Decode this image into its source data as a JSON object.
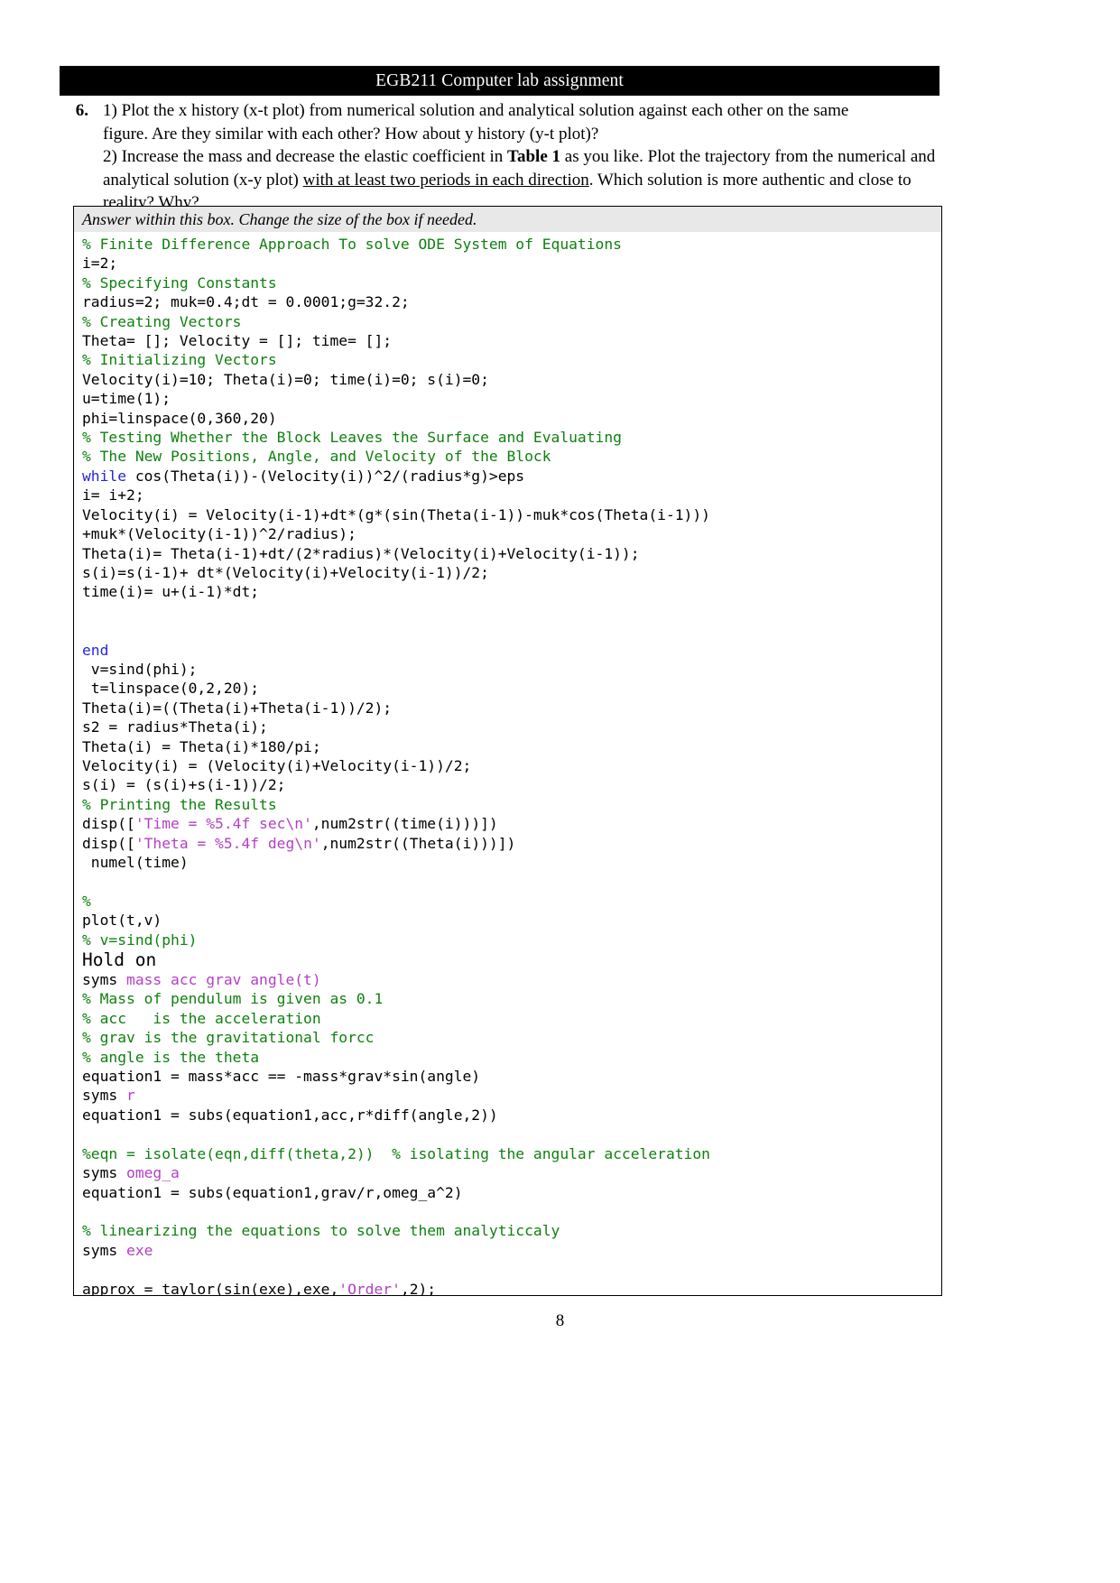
{
  "header": {
    "title": "EGB211 Computer lab assignment"
  },
  "question": {
    "number": "6.",
    "lines": [
      "1) Plot the x history (x-t plot) from numerical solution and analytical solution against each other on the same",
      "figure. Are they similar with each other? How about y history (y-t plot)?"
    ],
    "part2_pre": "2) Increase the mass and decrease the elastic coefficient in ",
    "part2_bold": "Table 1",
    "part2_mid": " as you like. Plot the trajectory from the",
    "part2_line2_pre": "numerical and analytical solution (x-y plot) ",
    "part2_underline": "with at least two periods in each direction",
    "part2_line2_post": ". Which solution is more",
    "part2_line3": "authentic and close to reality? Why?"
  },
  "answer_box": {
    "hint": "Answer within this box. Change the size of the box if needed."
  },
  "code": {
    "lines": [
      [
        {
          "t": "comment",
          "s": "% Finite Difference Approach To solve ODE System of Equations"
        }
      ],
      [
        {
          "t": "plain",
          "s": "i=2;"
        }
      ],
      [
        {
          "t": "comment",
          "s": "% Specifying Constants"
        }
      ],
      [
        {
          "t": "plain",
          "s": "radius=2; muk=0.4;dt = 0.0001;g=32.2;"
        }
      ],
      [
        {
          "t": "comment",
          "s": "% Creating Vectors"
        }
      ],
      [
        {
          "t": "plain",
          "s": "Theta= []; Velocity = []; time= [];"
        }
      ],
      [
        {
          "t": "comment",
          "s": "% Initializing Vectors"
        }
      ],
      [
        {
          "t": "plain",
          "s": "Velocity(i)=10; Theta(i)=0; time(i)=0; s(i)=0;"
        }
      ],
      [
        {
          "t": "plain",
          "s": "u=time(1);"
        }
      ],
      [
        {
          "t": "plain",
          "s": "phi=linspace(0,360,20)"
        }
      ],
      [
        {
          "t": "comment",
          "s": "% Testing Whether the Block Leaves the Surface and Evaluating"
        }
      ],
      [
        {
          "t": "comment",
          "s": "% The New Positions, Angle, and Velocity of the Block"
        }
      ],
      [
        {
          "t": "keyword",
          "s": "while"
        },
        {
          "t": "plain",
          "s": " cos(Theta(i))-(Velocity(i))^2/(radius*g)>eps"
        }
      ],
      [
        {
          "t": "plain",
          "s": "i= i+2;"
        }
      ],
      [
        {
          "t": "plain",
          "s": "Velocity(i) = Velocity(i-1)+dt*(g*(sin(Theta(i-1))-muk*cos(Theta(i-1)))"
        }
      ],
      [
        {
          "t": "plain",
          "s": "+muk*(Velocity(i-1))^2/radius);"
        }
      ],
      [
        {
          "t": "plain",
          "s": "Theta(i)= Theta(i-1)+dt/(2*radius)*(Velocity(i)+Velocity(i-1));"
        }
      ],
      [
        {
          "t": "plain",
          "s": "s(i)=s(i-1)+ dt*(Velocity(i)+Velocity(i-1))/2;"
        }
      ],
      [
        {
          "t": "plain",
          "s": "time(i)= u+(i-1)*dt;"
        }
      ],
      [
        {
          "t": "plain",
          "s": ""
        }
      ],
      [
        {
          "t": "plain",
          "s": ""
        }
      ],
      [
        {
          "t": "keyword",
          "s": "end"
        }
      ],
      [
        {
          "t": "plain",
          "s": " v=sind(phi);"
        }
      ],
      [
        {
          "t": "plain",
          "s": " t=linspace(0,2,20);"
        }
      ],
      [
        {
          "t": "plain",
          "s": "Theta(i)=((Theta(i)+Theta(i-1))/2);"
        }
      ],
      [
        {
          "t": "plain",
          "s": "s2 = radius*Theta(i);"
        }
      ],
      [
        {
          "t": "plain",
          "s": "Theta(i) = Theta(i)*180/pi;"
        }
      ],
      [
        {
          "t": "plain",
          "s": "Velocity(i) = (Velocity(i)+Velocity(i-1))/2;"
        }
      ],
      [
        {
          "t": "plain",
          "s": "s(i) = (s(i)+s(i-1))/2;"
        }
      ],
      [
        {
          "t": "comment",
          "s": "% Printing the Results"
        }
      ],
      [
        {
          "t": "plain",
          "s": "disp(["
        },
        {
          "t": "string",
          "s": "'Time = %5.4f sec\\n'"
        },
        {
          "t": "plain",
          "s": ",num2str((time(i)))])"
        }
      ],
      [
        {
          "t": "plain",
          "s": "disp(["
        },
        {
          "t": "string",
          "s": "'Theta = %5.4f deg\\n'"
        },
        {
          "t": "plain",
          "s": ",num2str((Theta(i)))])"
        }
      ],
      [
        {
          "t": "plain",
          "s": " numel(time)"
        }
      ],
      [
        {
          "t": "plain",
          "s": ""
        }
      ],
      [
        {
          "t": "comment",
          "s": "%"
        }
      ],
      [
        {
          "t": "plain",
          "s": "plot(t,v)"
        }
      ],
      [
        {
          "t": "comment",
          "s": "% v=sind(phi)"
        }
      ],
      [
        {
          "t": "plain",
          "s": "Hold on",
          "big": true
        }
      ],
      [
        {
          "t": "plain",
          "s": "syms "
        },
        {
          "t": "string",
          "s": "mass acc grav angle(t)"
        }
      ],
      [
        {
          "t": "comment",
          "s": "% Mass of pendulum is given as 0.1"
        }
      ],
      [
        {
          "t": "comment",
          "s": "% acc   is the acceleration"
        }
      ],
      [
        {
          "t": "comment",
          "s": "% grav is the gravitational forcc"
        }
      ],
      [
        {
          "t": "comment",
          "s": "% angle is the theta"
        }
      ],
      [
        {
          "t": "plain",
          "s": "equation1 = mass*acc == -mass*grav*sin(angle)"
        }
      ],
      [
        {
          "t": "plain",
          "s": "syms "
        },
        {
          "t": "string",
          "s": "r"
        }
      ],
      [
        {
          "t": "plain",
          "s": "equation1 = subs(equation1,acc,r*diff(angle,2))"
        }
      ],
      [
        {
          "t": "plain",
          "s": ""
        }
      ],
      [
        {
          "t": "comment",
          "s": "%eqn = isolate(eqn,diff(theta,2))  % isolating the angular acceleration"
        }
      ],
      [
        {
          "t": "plain",
          "s": "syms "
        },
        {
          "t": "string",
          "s": "omeg_a"
        }
      ],
      [
        {
          "t": "plain",
          "s": "equation1 = subs(equation1,grav/r,omeg_a^2)"
        }
      ],
      [
        {
          "t": "plain",
          "s": ""
        }
      ],
      [
        {
          "t": "comment",
          "s": "% linearizing the equations to solve them analyticcaly"
        }
      ],
      [
        {
          "t": "plain",
          "s": "syms "
        },
        {
          "t": "string",
          "s": "exe"
        }
      ],
      [
        {
          "t": "plain",
          "s": ""
        }
      ],
      [
        {
          "t": "plain",
          "s": "approx = taylor(sin(exe),exe,"
        },
        {
          "t": "string",
          "s": "'Order'"
        },
        {
          "t": "plain",
          "s": ",2);"
        }
      ]
    ]
  },
  "footer": {
    "page_number": "8"
  },
  "colors": {
    "comment": "#108010",
    "keyword": "#2727d8",
    "string": "#b341c4",
    "plain": "#000000",
    "banner_bg": "#000000",
    "hint_bg": "#e8e8e8"
  }
}
